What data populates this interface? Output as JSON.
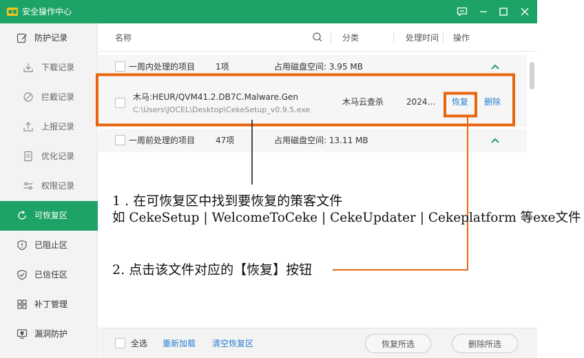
{
  "window": {
    "title": "安全操作中心",
    "accent_color": "#1da365",
    "controls": [
      "feedback-icon",
      "minimize-icon",
      "maximize-icon",
      "close-icon"
    ]
  },
  "sidebar": {
    "items": [
      {
        "label": "防护记录",
        "icon": "edit-icon",
        "level": "top"
      },
      {
        "label": "下载记录",
        "icon": "download-icon",
        "level": "sub"
      },
      {
        "label": "拦截记录",
        "icon": "block-icon",
        "level": "sub"
      },
      {
        "label": "上报记录",
        "icon": "upload-icon",
        "level": "sub"
      },
      {
        "label": "优化记录",
        "icon": "document-icon",
        "level": "sub"
      },
      {
        "label": "权限记录",
        "icon": "sliders-icon",
        "level": "sub"
      },
      {
        "label": "可恢复区",
        "icon": "restore-icon",
        "level": "top",
        "active": true
      },
      {
        "label": "已阻止区",
        "icon": "shield-blocked-icon",
        "level": "top"
      },
      {
        "label": "已信任区",
        "icon": "shield-check-icon",
        "level": "top"
      },
      {
        "label": "补丁管理",
        "icon": "grid-icon",
        "level": "top"
      },
      {
        "label": "漏洞防护",
        "icon": "screen-shield-icon",
        "level": "top"
      }
    ]
  },
  "list": {
    "columns": {
      "name": "名称",
      "category": "分类",
      "time": "处理时间",
      "action": "操作"
    },
    "groups": [
      {
        "label": "一周内处理的项目",
        "count": "1项",
        "disk": "占用磁盘空间: 3.95 MB"
      },
      {
        "label": "一周前处理的项目",
        "count": "47项",
        "disk": "占用磁盘空间: 13.11 MB"
      }
    ],
    "item": {
      "name": "木马:HEUR/QVM41.2.DB7C.Malware.Gen",
      "path": "C:\\Users\\JOCEL\\Desktop\\CekeSetup_v0.9.5.exe",
      "category": "木马云查杀",
      "time": "2024...",
      "restore": "恢复",
      "delete": "删除"
    }
  },
  "footer": {
    "select_all": "全选",
    "reload": "重新加载",
    "clear": "清空恢复区",
    "restore_selected": "恢复所选",
    "delete_selected": "删除所选"
  },
  "annotations": {
    "highlight_color": "#e8650e",
    "step1_line1": "1 . 在可恢复区中找到要恢复的策客文件",
    "step1_line2": "如 CekeSetup | WelcomeToCeke | CekeUpdater | Cekeplatform 等exe文件",
    "step2": "2. 点击该文件对应的【恢复】按钮"
  }
}
